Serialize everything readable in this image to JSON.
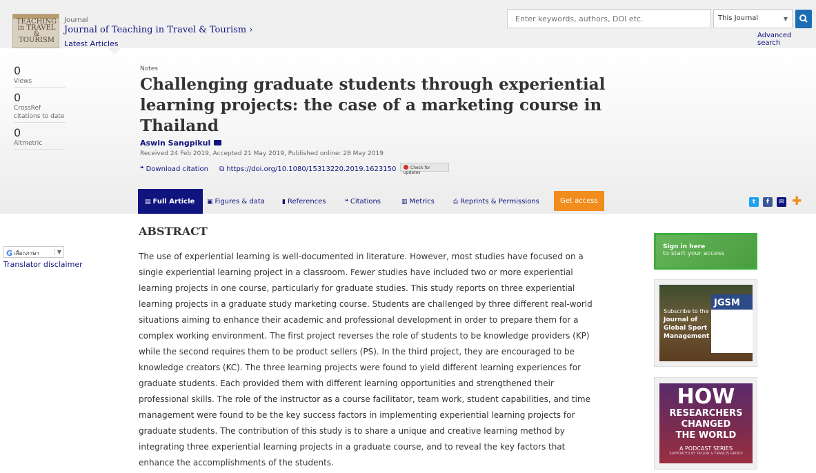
{
  "header": {
    "journal_label": "Journal",
    "journal_title": "Journal of Teaching in Travel & Tourism ›",
    "latest_articles": "Latest Articles",
    "cover_text": "TEACHING in TRAVEL & TOURISM",
    "search": {
      "placeholder": "Enter keywords, authors, DOI etc.",
      "scope": "This Journal",
      "advanced": "Advanced search"
    }
  },
  "metrics": [
    {
      "value": "0",
      "label": "Views"
    },
    {
      "value": "0",
      "label": "CrossRef citations to date"
    },
    {
      "value": "0",
      "label": "Altmetric"
    }
  ],
  "article": {
    "type": "Notes",
    "title": "Challenging graduate students through experiential learning projects: the case of a marketing course in Thailand",
    "author": "Aswin Sangpikul",
    "dates": "Received 24 Feb 2019, Accepted 21 May 2019, Published online: 28 May 2019",
    "download_citation": "Download citation",
    "doi": "https://doi.org/10.1080/15313220.2019.1623150",
    "check_updates": "Check for updates"
  },
  "tabs": [
    {
      "label": "Full Article"
    },
    {
      "label": "Figures & data"
    },
    {
      "label": "References"
    },
    {
      "label": "Citations"
    },
    {
      "label": "Metrics"
    },
    {
      "label": "Reprints & Permissions"
    }
  ],
  "get_access": "Get access",
  "translate": {
    "select_label": "เลือกภาษา",
    "disclaimer": "Translator disclaimer"
  },
  "abstract": {
    "heading": "ABSTRACT",
    "text": "The use of experiential learning is well-documented in literature. However, most studies have focused on a single experiential learning project in a classroom. Fewer studies have included two or more experiential learning projects in one course, particularly for graduate studies. This study reports on three experiential learning projects in a graduate study marketing course. Students are challenged by three different real-world situations aiming to enhance their academic and professional development in order to prepare them for a complex working environment. The first project reverses the role of students to be knowledge providers (KP) while the second requires them to be product sellers (PS). In the third project, they are encouraged to be knowledge creators (KC). The three learning projects were found to yield different learning experiences for graduate students. Each provided them with different learning opportunities and strengthened their professional skills. The role of the instructor as a course facilitator, team work, student capabilities, and time management were found to be the key success factors in implementing experiential learning projects for graduate students. The contribution of this study is to share a unique and creative learning method by integrating three experiential learning projects in a graduate course, and to reveal the key factors that enhance the accomplishments of the students."
  },
  "sidebar": {
    "signin_title": "Sign in here",
    "signin_sub": "to start your access",
    "ad1": {
      "line1": "Subscribe to the",
      "line2": "Journal of Global Sport Management",
      "cover_title": "JGSM"
    },
    "ad2": {
      "how": "HOW",
      "line1": "RESEARCHERS",
      "line2": "CHANGED",
      "line3": "THE WORLD",
      "podcast": "A PODCAST SERIES",
      "supported": "SUPPORTED BY TAYLOR & FRANCIS GROUP"
    }
  },
  "colors": {
    "brand_navy": "#10147e",
    "get_access": "#f28c1c",
    "signin_green": "#3fad3f"
  }
}
